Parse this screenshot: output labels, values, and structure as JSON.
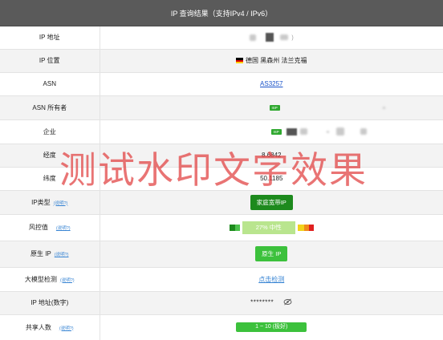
{
  "header": {
    "title": "IP 查询结果（支持IPv4 / IPv6）"
  },
  "rows": {
    "ip_address": {
      "label": "IP 地址"
    },
    "ip_location": {
      "label": "IP 位置",
      "value": "德国 黑森州 法兰克福"
    },
    "asn": {
      "label": "ASN",
      "value": "AS3257"
    },
    "asn_owner": {
      "label": "ASN 所有者",
      "tag": "ISP"
    },
    "enterprise": {
      "label": "企业",
      "tag": "ISP"
    },
    "longitude": {
      "label": "经度",
      "value": "8.6842"
    },
    "latitude": {
      "label": "纬度",
      "value": "50.1185"
    },
    "ip_type": {
      "label": "IP类型",
      "help": "(说明?)",
      "value": "家庭宽带IP"
    },
    "risk": {
      "label": "风控值",
      "help": "(说明?)",
      "value": "27%  中性",
      "percent": 27
    },
    "native_ip": {
      "label": "原生 IP",
      "help": "(说明?)",
      "value": "原生 IP"
    },
    "llm_check": {
      "label": "大模型检测",
      "help": "(说明?)",
      "value": "点击检测"
    },
    "ip_numeric": {
      "label": "IP 地址(数字)",
      "value": "********"
    },
    "shared_users": {
      "label": "共享人数",
      "help": "(说明?)",
      "value": "1 ~ 10 (极好)"
    }
  },
  "watermark": {
    "text": "测试水印文字效果"
  },
  "colors": {
    "header_bg": "#5a5a5a",
    "risk_green": "#b9e58e",
    "badge_dark_green": "#1d8a1d",
    "badge_green": "#3cc13c",
    "link_blue": "#1a53c9",
    "watermark": "#e14646"
  },
  "icons": {
    "flag": "germany-flag-icon",
    "eye": "eye-slash-icon"
  }
}
